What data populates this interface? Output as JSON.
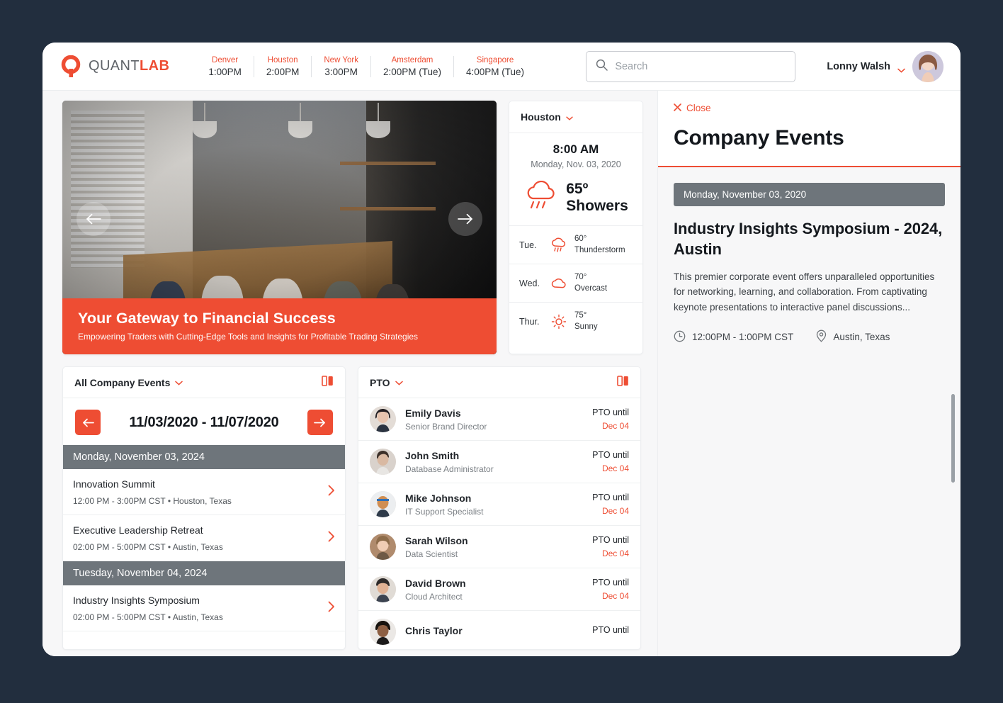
{
  "brand": {
    "name_part1": "QUANT",
    "name_part2": "LAB",
    "logo_icon": "quantlab-q-logo"
  },
  "accent_color": "#ee4d33",
  "dark_bg_color": "#222e3e",
  "clocks": [
    {
      "city": "Denver",
      "time": "1:00PM"
    },
    {
      "city": "Houston",
      "time": "2:00PM"
    },
    {
      "city": "New York",
      "time": "3:00PM"
    },
    {
      "city": "Amsterdam",
      "time": "2:00PM (Tue)"
    },
    {
      "city": "Singapore",
      "time": "4:00PM (Tue)"
    }
  ],
  "search": {
    "placeholder": "Search",
    "value": "",
    "icon": "search-icon"
  },
  "user": {
    "name": "Lonny Walsh",
    "chevron_icon": "chevron-down-icon",
    "avatar_icon": "user-avatar"
  },
  "hero": {
    "title": "Your Gateway to Financial Success",
    "subtitle": "Empowering Traders with Cutting-Edge Tools and Insights for Profitable Trading Strategies",
    "prev_icon": "arrow-left-icon",
    "next_icon": "arrow-right-icon",
    "dots_total": 5,
    "dot_active_index": 0
  },
  "weather": {
    "city": "Houston",
    "chevron_icon": "chevron-down-icon",
    "time": "8:00 AM",
    "date": "Monday, Nov. 03, 2020",
    "current_temp": "65º",
    "current_condition": "Showers",
    "current_icon": "showers-icon",
    "forecast": [
      {
        "day": "Tue.",
        "icon": "thunderstorm-icon",
        "temp": "60°",
        "condition": "Thunderstorm"
      },
      {
        "day": "Wed.",
        "icon": "cloud-icon",
        "temp": "70°",
        "condition": "Overcast"
      },
      {
        "day": "Thur.",
        "icon": "sun-icon",
        "temp": "75°",
        "condition": "Sunny"
      }
    ]
  },
  "events_card": {
    "title": "All Company Events",
    "chevron_icon": "chevron-down-icon",
    "panel_icon": "split-panel-icon",
    "prev_icon": "arrow-left-icon",
    "next_icon": "arrow-right-icon",
    "date_range": "11/03/2020 - 11/07/2020",
    "groups": [
      {
        "day": "Monday, November 03, 2024",
        "events": [
          {
            "name": "Innovation Summit",
            "meta": "12:00 PM - 3:00PM CST • Houston, Texas",
            "arrow_icon": "chevron-right-icon"
          },
          {
            "name": "Executive Leadership Retreat",
            "meta": "02:00 PM - 5:00PM CST • Austin, Texas",
            "arrow_icon": "chevron-right-icon"
          }
        ]
      },
      {
        "day": "Tuesday, November 04, 2024",
        "events": [
          {
            "name": "Industry Insights Symposium",
            "meta": "02:00 PM - 5:00PM CST • Austin, Texas",
            "arrow_icon": "chevron-right-icon"
          }
        ]
      }
    ]
  },
  "pto_card": {
    "title": "PTO",
    "chevron_icon": "chevron-down-icon",
    "panel_icon": "split-panel-icon",
    "people": [
      {
        "name": "Emily Davis",
        "role": "Senior Brand Director",
        "label": "PTO until",
        "date": "Dec 04"
      },
      {
        "name": "John Smith",
        "role": "Database Administrator",
        "label": "PTO until",
        "date": "Dec 04"
      },
      {
        "name": "Mike Johnson",
        "role": "IT Support Specialist",
        "label": "PTO until",
        "date": "Dec 04"
      },
      {
        "name": "Sarah Wilson",
        "role": "Data Scientist",
        "label": "PTO until",
        "date": "Dec 04"
      },
      {
        "name": "David Brown",
        "role": "Cloud Architect",
        "label": "PTO until",
        "date": "Dec 04"
      },
      {
        "name": "Chris Taylor",
        "role": "",
        "label": "PTO until",
        "date": ""
      }
    ]
  },
  "right_panel": {
    "close_label": "Close",
    "close_icon": "close-x-icon",
    "title": "Company Events",
    "day_bar": "Monday, November 03, 2020",
    "event_title": "Industry Insights Symposium - 2024, Austin",
    "description": "This premier corporate event offers unparalleled opportunities for networking, learning, and collaboration. From captivating keynote presentations to interactive panel discussions...",
    "time": "12:00PM - 1:00PM CST",
    "time_icon": "clock-icon",
    "location": "Austin, Texas",
    "location_icon": "map-pin-icon"
  }
}
